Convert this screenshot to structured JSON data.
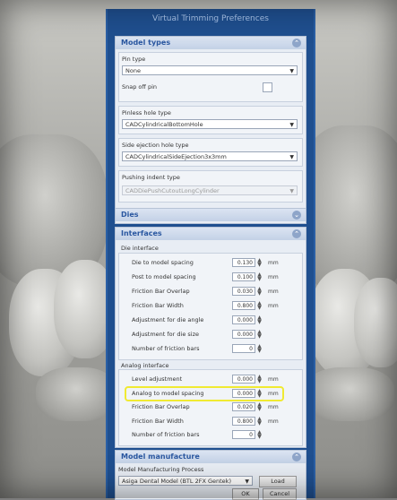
{
  "window": {
    "title": "Virtual Trimming Preferences"
  },
  "model_types": {
    "header": "Model types",
    "pin_type_label": "Pin type",
    "pin_type_value": "None",
    "snap_off_label": "Snap off pin",
    "pinless_label": "Pinless hole type",
    "pinless_value": "CADCylindricalBottomHole",
    "side_ejection_label": "Side ejection hole type",
    "side_ejection_value": "CADCylindricalSideEjection3x3mm",
    "pushing_label": "Pushing indent type",
    "pushing_value": "CADDiePushCutoutLongCylinder"
  },
  "dies": {
    "header": "Dies"
  },
  "interfaces": {
    "header": "Interfaces",
    "die_group_label": "Die interface",
    "die_rows": [
      {
        "label": "Die to model spacing",
        "value": "0.130",
        "unit": "mm"
      },
      {
        "label": "Post to model spacing",
        "value": "0.100",
        "unit": "mm"
      },
      {
        "label": "Friction Bar Overlap",
        "value": "0.030",
        "unit": "mm"
      },
      {
        "label": "Friction Bar Width",
        "value": "0.800",
        "unit": "mm"
      },
      {
        "label": "Adjustment for die angle",
        "value": "0.000",
        "unit": ""
      },
      {
        "label": "Adjustment for die size",
        "value": "0.000",
        "unit": ""
      },
      {
        "label": "Number of friction bars",
        "value": "0",
        "unit": ""
      }
    ],
    "analog_group_label": "Analog interface",
    "analog_rows": [
      {
        "label": "Level adjustment",
        "value": "0.000",
        "unit": "mm"
      },
      {
        "label": "Analog to model spacing",
        "value": "0.000",
        "unit": "mm"
      },
      {
        "label": "Friction Bar Overlap",
        "value": "0.020",
        "unit": "mm"
      },
      {
        "label": "Friction Bar Width",
        "value": "0.800",
        "unit": "mm"
      },
      {
        "label": "Number of friction bars",
        "value": "0",
        "unit": ""
      }
    ]
  },
  "model_manufacture": {
    "header": "Model manufacture",
    "process_label": "Model Manufacturing Process",
    "process_value": "Asiga Dental Model (BTL 2FX Gentek)",
    "load_label": "Load"
  },
  "footer": {
    "ok_label": "OK",
    "cancel_label": "Cancel"
  },
  "colors": {
    "accent": "#2a57a0",
    "highlight": "#f0ea32",
    "dialog_frame": "#1f4f8f"
  }
}
